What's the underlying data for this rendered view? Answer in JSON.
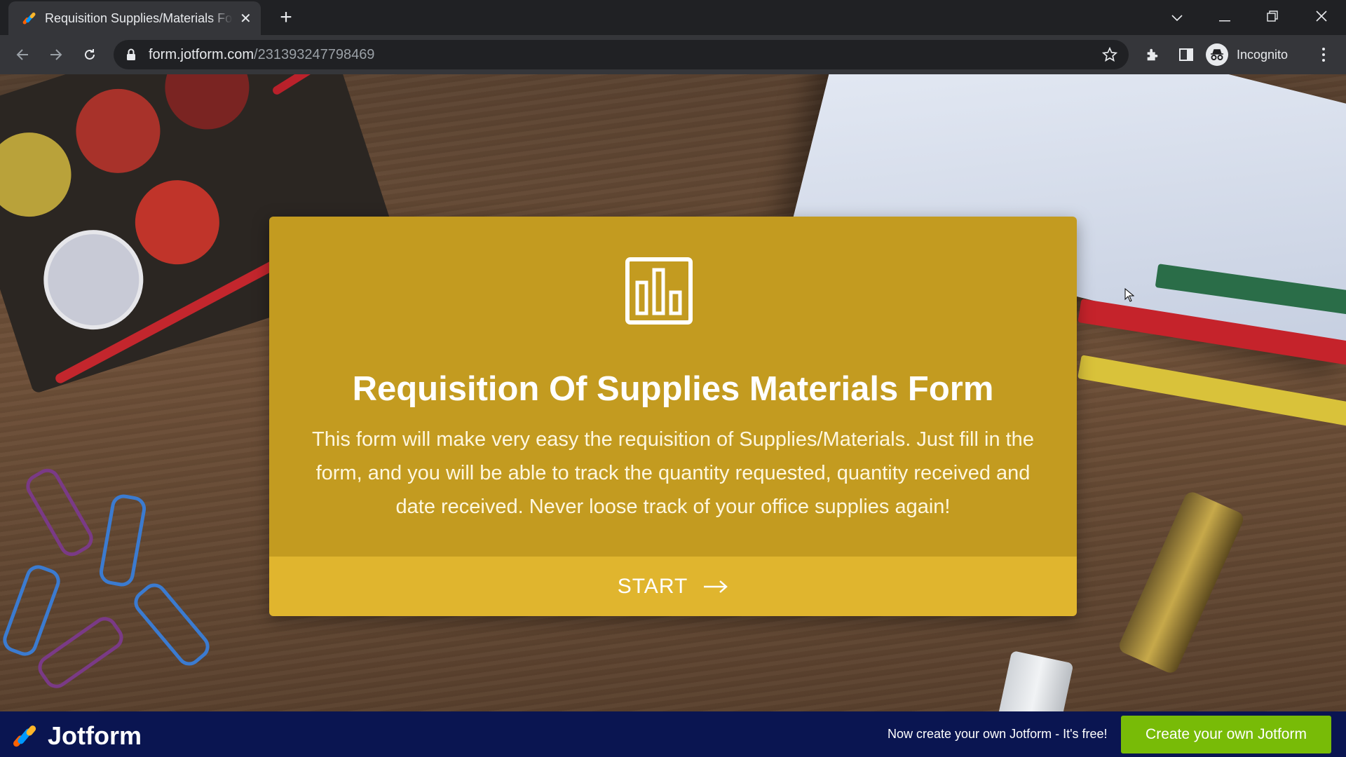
{
  "browser": {
    "tab_title": "Requisition Supplies/Materials Form",
    "url_host": "form.jotform.com",
    "url_path": "/231393247798469",
    "profile_label": "Incognito",
    "icons": [
      "back-icon",
      "forward-icon",
      "reload-icon",
      "lock-icon",
      "star-icon",
      "extensions-icon",
      "sidebar-icon",
      "incognito-icon",
      "menu-icon",
      "tab-list-icon",
      "minimize-icon",
      "restore-icon",
      "close-icon"
    ]
  },
  "form": {
    "title": "Requisition Of Supplies Materials Form",
    "description": "This form will make very easy the requisition of Supplies/Materials. Just fill in the form, and you will be able to track the quantity requested, quantity received and date received. Never loose track of your office supplies again!",
    "start_label": "START",
    "icon": "bar-chart-icon",
    "colors": {
      "card": "#c39b20",
      "start_bar": "#e0b52e"
    }
  },
  "footer": {
    "brand": "Jotform",
    "promo_text": "Now create your own Jotform - It's free!",
    "cta_label": "Create your own Jotform",
    "colors": {
      "bar": "#0a1551",
      "cta": "#78bb07"
    }
  }
}
